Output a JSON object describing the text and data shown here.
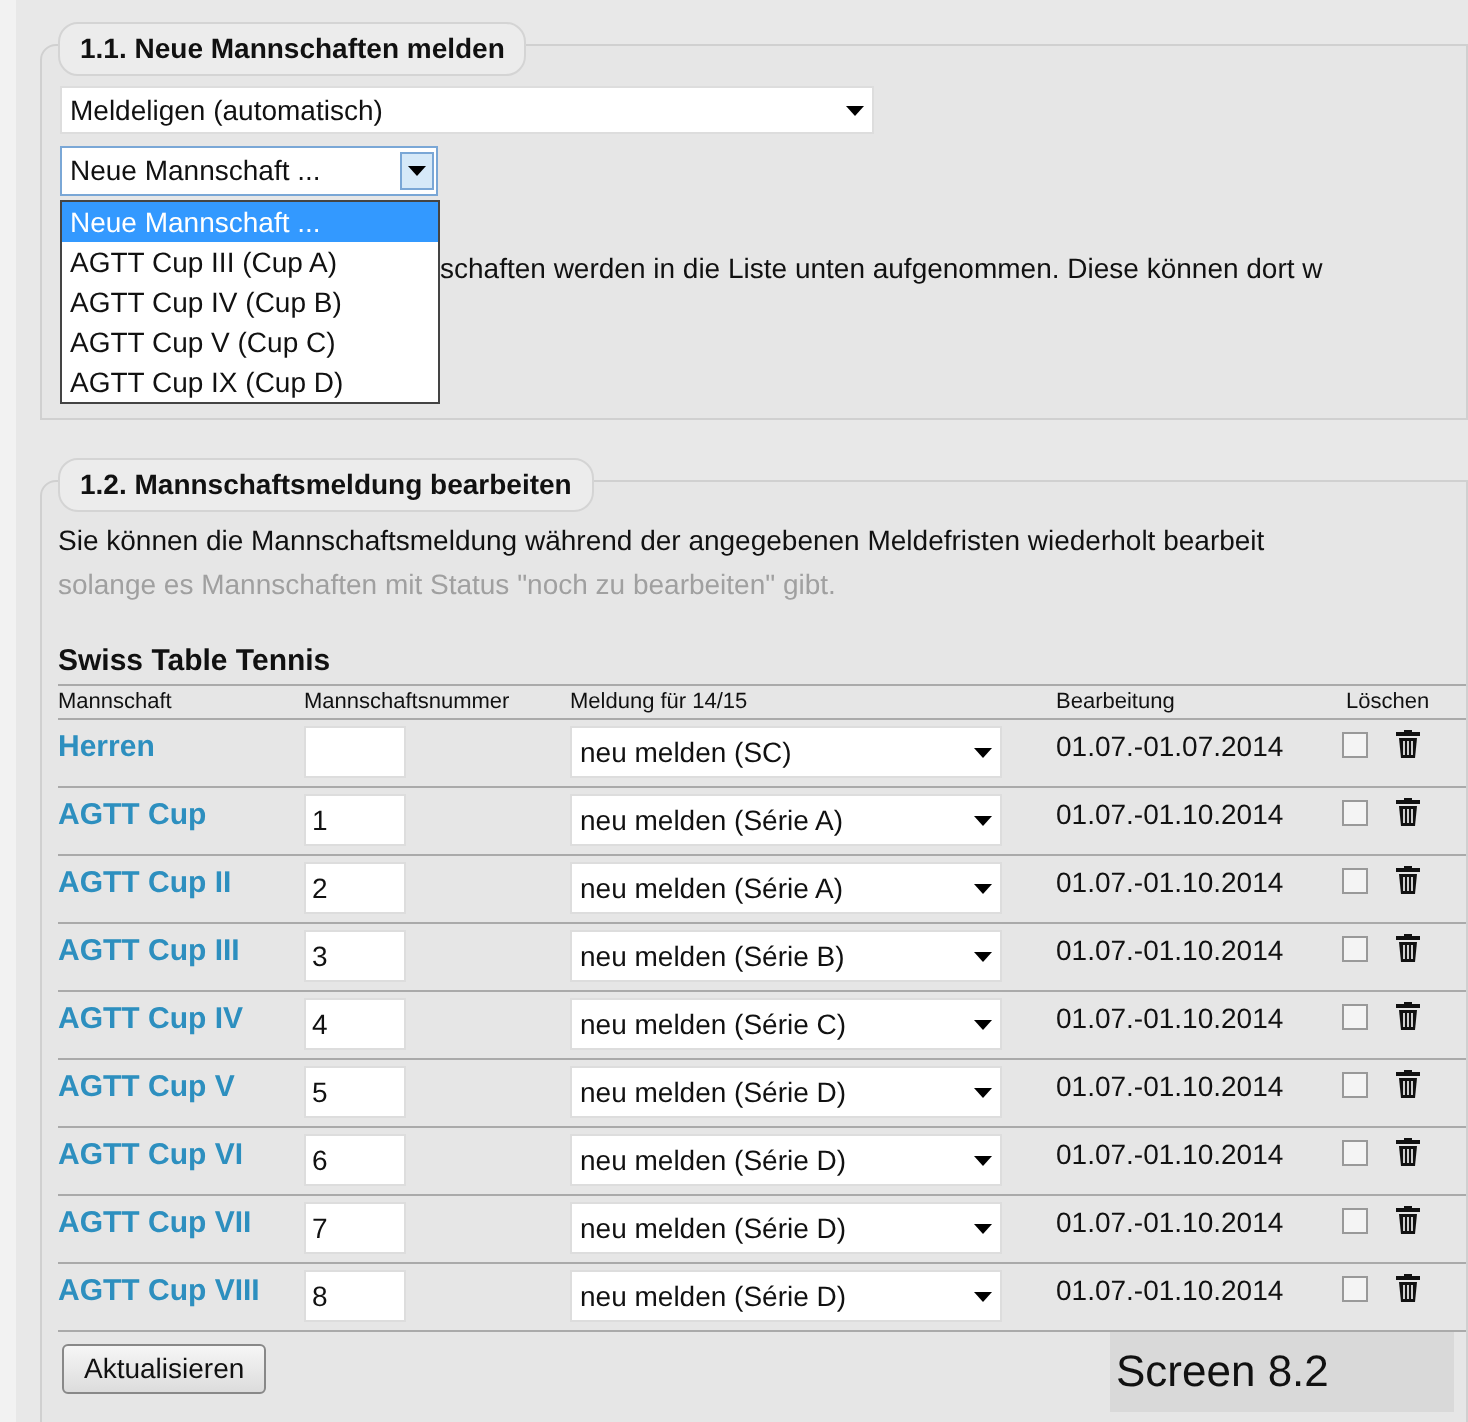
{
  "section_new": {
    "legend": "1.1. Neue Mannschaften melden",
    "league_select": {
      "value": "Meldeligen (automatisch)"
    },
    "team_select": {
      "value": "Neue Mannschaft ...",
      "expanded": true,
      "options": [
        {
          "label": "Neue Mannschaft ...",
          "selected": true
        },
        {
          "label": "AGTT Cup III (Cup A)",
          "selected": false
        },
        {
          "label": "AGTT Cup IV (Cup B)",
          "selected": false
        },
        {
          "label": "AGTT Cup V (Cup C)",
          "selected": false
        },
        {
          "label": "AGTT Cup IX (Cup D)",
          "selected": false
        }
      ]
    },
    "info_text": "schaften werden in die Liste unten aufgenommen. Diese können dort w"
  },
  "section_edit": {
    "legend": "1.2. Mannschaftsmeldung bearbeiten",
    "intro": "Sie können die Mannschaftsmeldung während der angegebenen Meldefristen wiederholt bearbeit",
    "note": "solange es Mannschaften mit Status \"noch zu bearbeiten\" gibt.",
    "table_title": "Swiss Table Tennis",
    "columns": [
      "Mannschaft",
      "Mannschaftsnummer",
      "Meldung für 14/15",
      "Bearbeitung",
      "Löschen"
    ],
    "rows": [
      {
        "team": "Herren",
        "number": "",
        "report": "neu melden (SC)",
        "period": "01.07.-01.07.2014",
        "checked": false
      },
      {
        "team": "AGTT Cup",
        "number": "1",
        "report": "neu melden (Série A)",
        "period": "01.07.-01.10.2014",
        "checked": false
      },
      {
        "team": "AGTT Cup II",
        "number": "2",
        "report": "neu melden (Série A)",
        "period": "01.07.-01.10.2014",
        "checked": false
      },
      {
        "team": "AGTT Cup III",
        "number": "3",
        "report": "neu melden (Série B)",
        "period": "01.07.-01.10.2014",
        "checked": false
      },
      {
        "team": "AGTT Cup IV",
        "number": "4",
        "report": "neu melden (Série C)",
        "period": "01.07.-01.10.2014",
        "checked": false
      },
      {
        "team": "AGTT Cup V",
        "number": "5",
        "report": "neu melden (Série D)",
        "period": "01.07.-01.10.2014",
        "checked": false
      },
      {
        "team": "AGTT Cup VI",
        "number": "6",
        "report": "neu melden (Série D)",
        "period": "01.07.-01.10.2014",
        "checked": false
      },
      {
        "team": "AGTT Cup VII",
        "number": "7",
        "report": "neu melden (Série D)",
        "period": "01.07.-01.10.2014",
        "checked": false
      },
      {
        "team": "AGTT Cup VIII",
        "number": "8",
        "report": "neu melden (Série D)",
        "period": "01.07.-01.10.2014",
        "checked": false
      }
    ],
    "update_button": "Aktualisieren"
  },
  "caption": "Screen 8.2"
}
